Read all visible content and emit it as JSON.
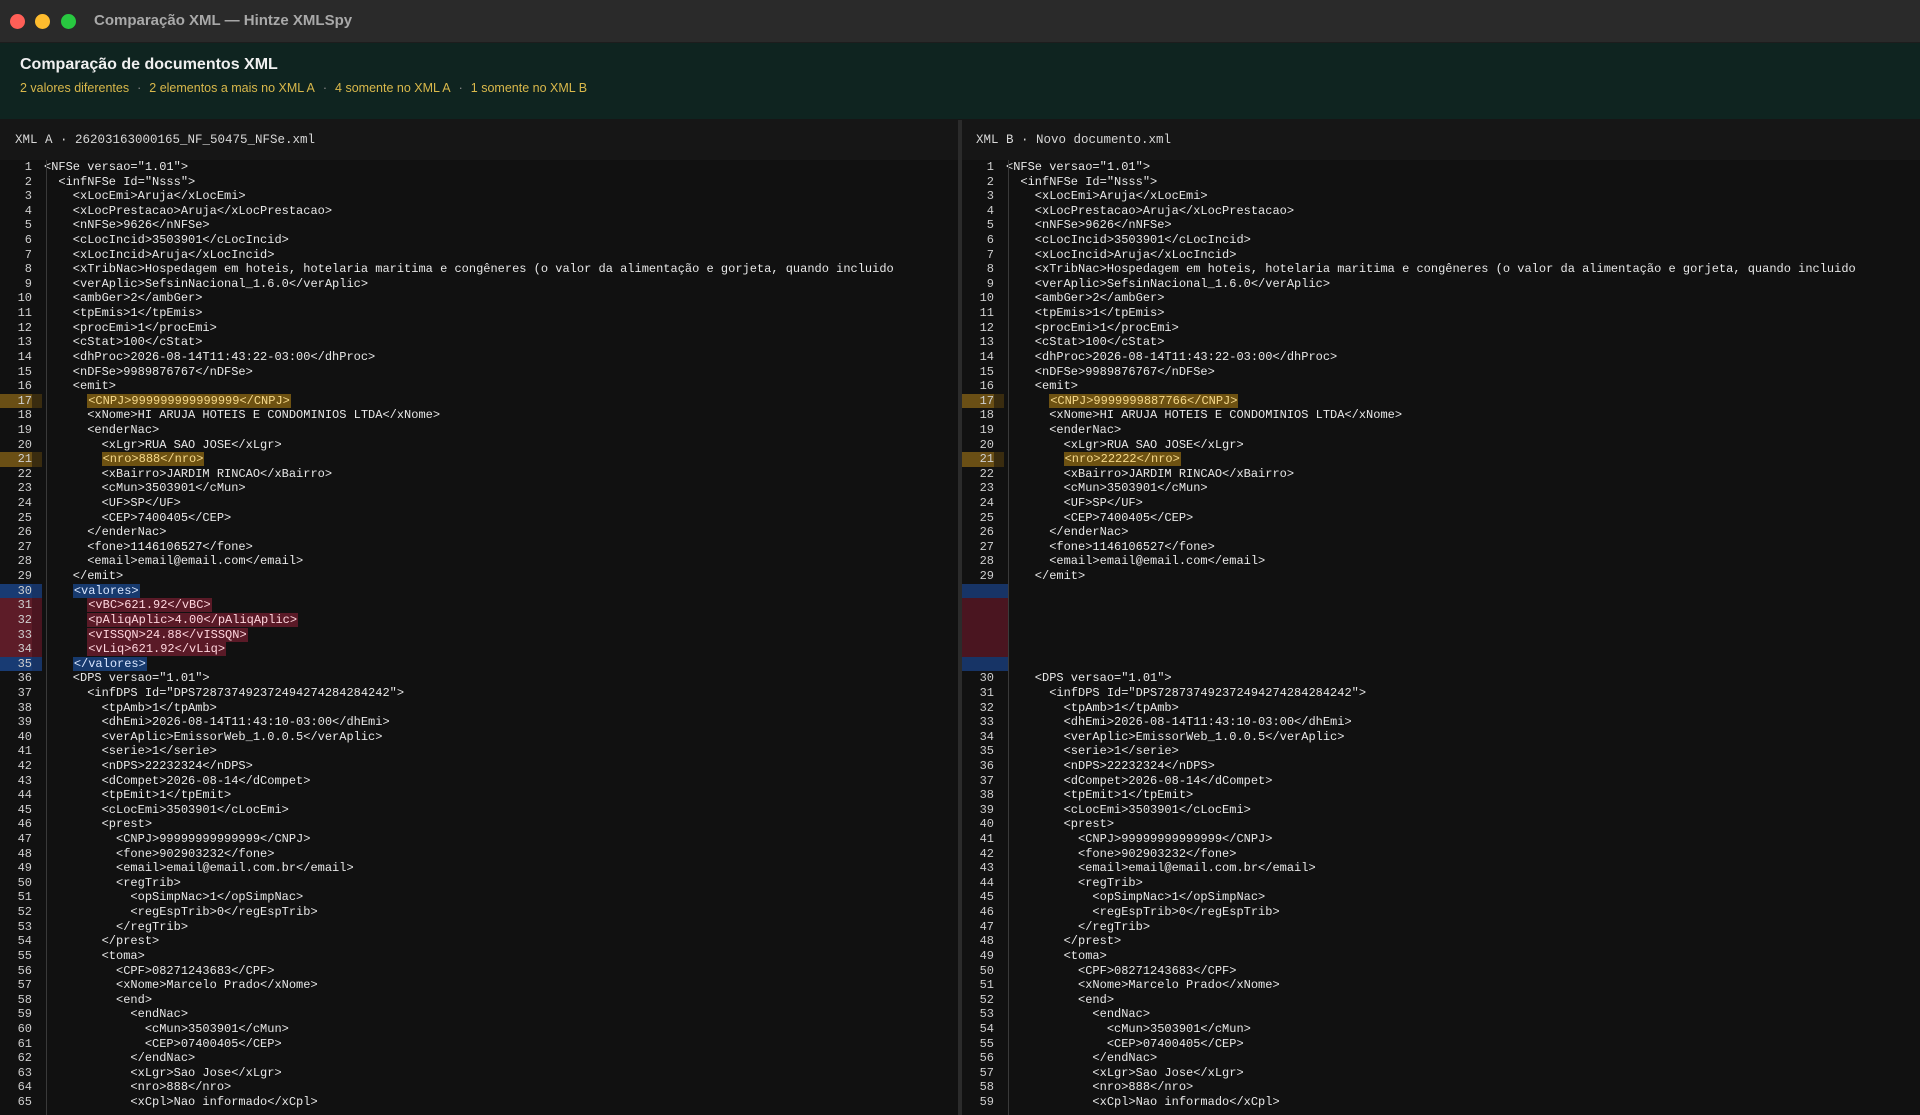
{
  "window": {
    "title": "Comparação XML — Hintze XMLSpy"
  },
  "header": {
    "title": "Comparação de documentos XML",
    "summary": [
      "2 valores diferentes",
      "2 elementos a mais no XML A",
      "4 somente no XML A",
      "1 somente no XML B"
    ]
  },
  "colors": {
    "changed": "#6e5212",
    "only_a_boundary": "#173a6e",
    "only_a_fill": "#5a1a27",
    "summary": "#d9b84b",
    "header_bg": "#0f2420"
  },
  "pane_a": {
    "label": "XML A · 26203163000165_NF_50475_NFSe.xml"
  },
  "pane_b": {
    "label": "XML B · Novo documento.xml"
  },
  "lines_a": [
    {
      "n": "1",
      "t": "<NFSe versao=\"1.01\">",
      "s": "normal"
    },
    {
      "n": "2",
      "t": "  <infNFSe Id=\"Nsss\">",
      "s": "normal"
    },
    {
      "n": "3",
      "t": "    <xLocEmi>Aruja</xLocEmi>",
      "s": "normal"
    },
    {
      "n": "4",
      "t": "    <xLocPrestacao>Aruja</xLocPrestacao>",
      "s": "normal"
    },
    {
      "n": "5",
      "t": "    <nNFSe>9626</nNFSe>",
      "s": "normal"
    },
    {
      "n": "6",
      "t": "    <cLocIncid>3503901</cLocIncid>",
      "s": "normal"
    },
    {
      "n": "7",
      "t": "    <xLocIncid>Aruja</xLocIncid>",
      "s": "normal"
    },
    {
      "n": "8",
      "t": "    <xTribNac>Hospedagem em hoteis, hotelaria maritima e congêneres (o valor da alimentação e gorjeta, quando incluido",
      "s": "normal"
    },
    {
      "n": "9",
      "t": "    <verAplic>SefsinNacional_1.6.0</verAplic>",
      "s": "normal"
    },
    {
      "n": "10",
      "t": "    <ambGer>2</ambGer>",
      "s": "normal"
    },
    {
      "n": "11",
      "t": "    <tpEmis>1</tpEmis>",
      "s": "normal"
    },
    {
      "n": "12",
      "t": "    <procEmi>1</procEmi>",
      "s": "normal"
    },
    {
      "n": "13",
      "t": "    <cStat>100</cStat>",
      "s": "normal"
    },
    {
      "n": "14",
      "t": "    <dhProc>2026-08-14T11:43:22-03:00</dhProc>",
      "s": "normal"
    },
    {
      "n": "15",
      "t": "    <nDFSe>9989876767</nDFSe>",
      "s": "normal"
    },
    {
      "n": "16",
      "t": "    <emit>",
      "s": "normal"
    },
    {
      "n": "17",
      "t": "      <CNPJ>999999999999999</CNPJ>",
      "s": "changed"
    },
    {
      "n": "18",
      "t": "      <xNome>HI ARUJA HOTEIS E CONDOMINIOS LTDA</xNome>",
      "s": "normal"
    },
    {
      "n": "19",
      "t": "      <enderNac>",
      "s": "normal"
    },
    {
      "n": "20",
      "t": "        <xLgr>RUA SAO JOSE</xLgr>",
      "s": "normal"
    },
    {
      "n": "21",
      "t": "        <nro>888</nro>",
      "s": "changed"
    },
    {
      "n": "22",
      "t": "        <xBairro>JARDIM RINCAO</xBairro>",
      "s": "normal"
    },
    {
      "n": "23",
      "t": "        <cMun>3503901</cMun>",
      "s": "normal"
    },
    {
      "n": "24",
      "t": "        <UF>SP</UF>",
      "s": "normal"
    },
    {
      "n": "25",
      "t": "        <CEP>7400405</CEP>",
      "s": "normal"
    },
    {
      "n": "26",
      "t": "      </enderNac>",
      "s": "normal"
    },
    {
      "n": "27",
      "t": "      <fone>1146106527</fone>",
      "s": "normal"
    },
    {
      "n": "28",
      "t": "      <email>email@email.com</email>",
      "s": "normal"
    },
    {
      "n": "29",
      "t": "    </emit>",
      "s": "normal"
    },
    {
      "n": "30",
      "t": "    <valores>",
      "s": "added-bound"
    },
    {
      "n": "31",
      "t": "      <vBC>621.92</vBC>",
      "s": "added"
    },
    {
      "n": "32",
      "t": "      <pAliqAplic>4.00</pAliqAplic>",
      "s": "added"
    },
    {
      "n": "33",
      "t": "      <vISSQN>24.88</vISSQN>",
      "s": "added"
    },
    {
      "n": "34",
      "t": "      <vLiq>621.92</vLiq>",
      "s": "added"
    },
    {
      "n": "35",
      "t": "    </valores>",
      "s": "added-bound"
    },
    {
      "n": "36",
      "t": "    <DPS versao=\"1.01\">",
      "s": "normal"
    },
    {
      "n": "37",
      "t": "      <infDPS Id=\"DPS728737492372494274284284242\">",
      "s": "normal"
    },
    {
      "n": "38",
      "t": "        <tpAmb>1</tpAmb>",
      "s": "normal"
    },
    {
      "n": "39",
      "t": "        <dhEmi>2026-08-14T11:43:10-03:00</dhEmi>",
      "s": "normal"
    },
    {
      "n": "40",
      "t": "        <verAplic>EmissorWeb_1.0.0.5</verAplic>",
      "s": "normal"
    },
    {
      "n": "41",
      "t": "        <serie>1</serie>",
      "s": "normal"
    },
    {
      "n": "42",
      "t": "        <nDPS>22232324</nDPS>",
      "s": "normal"
    },
    {
      "n": "43",
      "t": "        <dCompet>2026-08-14</dCompet>",
      "s": "normal"
    },
    {
      "n": "44",
      "t": "        <tpEmit>1</tpEmit>",
      "s": "normal"
    },
    {
      "n": "45",
      "t": "        <cLocEmi>3503901</cLocEmi>",
      "s": "normal"
    },
    {
      "n": "46",
      "t": "        <prest>",
      "s": "normal"
    },
    {
      "n": "47",
      "t": "          <CNPJ>99999999999999</CNPJ>",
      "s": "normal"
    },
    {
      "n": "48",
      "t": "          <fone>902903232</fone>",
      "s": "normal"
    },
    {
      "n": "49",
      "t": "          <email>email@email.com.br</email>",
      "s": "normal"
    },
    {
      "n": "50",
      "t": "          <regTrib>",
      "s": "normal"
    },
    {
      "n": "51",
      "t": "            <opSimpNac>1</opSimpNac>",
      "s": "normal"
    },
    {
      "n": "52",
      "t": "            <regEspTrib>0</regEspTrib>",
      "s": "normal"
    },
    {
      "n": "53",
      "t": "          </regTrib>",
      "s": "normal"
    },
    {
      "n": "54",
      "t": "        </prest>",
      "s": "normal"
    },
    {
      "n": "55",
      "t": "        <toma>",
      "s": "normal"
    },
    {
      "n": "56",
      "t": "          <CPF>08271243683</CPF>",
      "s": "normal"
    },
    {
      "n": "57",
      "t": "          <xNome>Marcelo Prado</xNome>",
      "s": "normal"
    },
    {
      "n": "58",
      "t": "          <end>",
      "s": "normal"
    },
    {
      "n": "59",
      "t": "            <endNac>",
      "s": "normal"
    },
    {
      "n": "60",
      "t": "              <cMun>3503901</cMun>",
      "s": "normal"
    },
    {
      "n": "61",
      "t": "              <CEP>07400405</CEP>",
      "s": "normal"
    },
    {
      "n": "62",
      "t": "            </endNac>",
      "s": "normal"
    },
    {
      "n": "63",
      "t": "            <xLgr>Sao Jose</xLgr>",
      "s": "normal"
    },
    {
      "n": "64",
      "t": "            <nro>888</nro>",
      "s": "normal"
    },
    {
      "n": "65",
      "t": "            <xCpl>Nao informado</xCpl>",
      "s": "normal"
    }
  ],
  "lines_b": [
    {
      "n": "1",
      "t": "<NFSe versao=\"1.01\">",
      "s": "normal"
    },
    {
      "n": "2",
      "t": "  <infNFSe Id=\"Nsss\">",
      "s": "normal"
    },
    {
      "n": "3",
      "t": "    <xLocEmi>Aruja</xLocEmi>",
      "s": "normal"
    },
    {
      "n": "4",
      "t": "    <xLocPrestacao>Aruja</xLocPrestacao>",
      "s": "normal"
    },
    {
      "n": "5",
      "t": "    <nNFSe>9626</nNFSe>",
      "s": "normal"
    },
    {
      "n": "6",
      "t": "    <cLocIncid>3503901</cLocIncid>",
      "s": "normal"
    },
    {
      "n": "7",
      "t": "    <xLocIncid>Aruja</xLocIncid>",
      "s": "normal"
    },
    {
      "n": "8",
      "t": "    <xTribNac>Hospedagem em hoteis, hotelaria maritima e congêneres (o valor da alimentação e gorjeta, quando incluido",
      "s": "normal"
    },
    {
      "n": "9",
      "t": "    <verAplic>SefsinNacional_1.6.0</verAplic>",
      "s": "normal"
    },
    {
      "n": "10",
      "t": "    <ambGer>2</ambGer>",
      "s": "normal"
    },
    {
      "n": "11",
      "t": "    <tpEmis>1</tpEmis>",
      "s": "normal"
    },
    {
      "n": "12",
      "t": "    <procEmi>1</procEmi>",
      "s": "normal"
    },
    {
      "n": "13",
      "t": "    <cStat>100</cStat>",
      "s": "normal"
    },
    {
      "n": "14",
      "t": "    <dhProc>2026-08-14T11:43:22-03:00</dhProc>",
      "s": "normal"
    },
    {
      "n": "15",
      "t": "    <nDFSe>9989876767</nDFSe>",
      "s": "normal"
    },
    {
      "n": "16",
      "t": "    <emit>",
      "s": "normal"
    },
    {
      "n": "17",
      "t": "      <CNPJ>9999999887766</CNPJ>",
      "s": "changed"
    },
    {
      "n": "18",
      "t": "      <xNome>HI ARUJA HOTEIS E CONDOMINIOS LTDA</xNome>",
      "s": "normal"
    },
    {
      "n": "19",
      "t": "      <enderNac>",
      "s": "normal"
    },
    {
      "n": "20",
      "t": "        <xLgr>RUA SAO JOSE</xLgr>",
      "s": "normal"
    },
    {
      "n": "21",
      "t": "        <nro>22222</nro>",
      "s": "changed"
    },
    {
      "n": "22",
      "t": "        <xBairro>JARDIM RINCAO</xBairro>",
      "s": "normal"
    },
    {
      "n": "23",
      "t": "        <cMun>3503901</cMun>",
      "s": "normal"
    },
    {
      "n": "24",
      "t": "        <UF>SP</UF>",
      "s": "normal"
    },
    {
      "n": "25",
      "t": "        <CEP>7400405</CEP>",
      "s": "normal"
    },
    {
      "n": "26",
      "t": "      </enderNac>",
      "s": "normal"
    },
    {
      "n": "27",
      "t": "      <fone>1146106527</fone>",
      "s": "normal"
    },
    {
      "n": "28",
      "t": "      <email>email@email.com</email>",
      "s": "normal"
    },
    {
      "n": "29",
      "t": "    </emit>",
      "s": "normal"
    },
    {
      "n": "",
      "t": "",
      "s": "ph-bound"
    },
    {
      "n": "",
      "t": "",
      "s": "ph-fill"
    },
    {
      "n": "",
      "t": "",
      "s": "ph-fill"
    },
    {
      "n": "",
      "t": "",
      "s": "ph-fill"
    },
    {
      "n": "",
      "t": "",
      "s": "ph-fill"
    },
    {
      "n": "",
      "t": "",
      "s": "ph-bound"
    },
    {
      "n": "30",
      "t": "    <DPS versao=\"1.01\">",
      "s": "normal"
    },
    {
      "n": "31",
      "t": "      <infDPS Id=\"DPS728737492372494274284284242\">",
      "s": "normal"
    },
    {
      "n": "32",
      "t": "        <tpAmb>1</tpAmb>",
      "s": "normal"
    },
    {
      "n": "33",
      "t": "        <dhEmi>2026-08-14T11:43:10-03:00</dhEmi>",
      "s": "normal"
    },
    {
      "n": "34",
      "t": "        <verAplic>EmissorWeb_1.0.0.5</verAplic>",
      "s": "normal"
    },
    {
      "n": "35",
      "t": "        <serie>1</serie>",
      "s": "normal"
    },
    {
      "n": "36",
      "t": "        <nDPS>22232324</nDPS>",
      "s": "normal"
    },
    {
      "n": "37",
      "t": "        <dCompet>2026-08-14</dCompet>",
      "s": "normal"
    },
    {
      "n": "38",
      "t": "        <tpEmit>1</tpEmit>",
      "s": "normal"
    },
    {
      "n": "39",
      "t": "        <cLocEmi>3503901</cLocEmi>",
      "s": "normal"
    },
    {
      "n": "40",
      "t": "        <prest>",
      "s": "normal"
    },
    {
      "n": "41",
      "t": "          <CNPJ>99999999999999</CNPJ>",
      "s": "normal"
    },
    {
      "n": "42",
      "t": "          <fone>902903232</fone>",
      "s": "normal"
    },
    {
      "n": "43",
      "t": "          <email>email@email.com.br</email>",
      "s": "normal"
    },
    {
      "n": "44",
      "t": "          <regTrib>",
      "s": "normal"
    },
    {
      "n": "45",
      "t": "            <opSimpNac>1</opSimpNac>",
      "s": "normal"
    },
    {
      "n": "46",
      "t": "            <regEspTrib>0</regEspTrib>",
      "s": "normal"
    },
    {
      "n": "47",
      "t": "          </regTrib>",
      "s": "normal"
    },
    {
      "n": "48",
      "t": "        </prest>",
      "s": "normal"
    },
    {
      "n": "49",
      "t": "        <toma>",
      "s": "normal"
    },
    {
      "n": "50",
      "t": "          <CPF>08271243683</CPF>",
      "s": "normal"
    },
    {
      "n": "51",
      "t": "          <xNome>Marcelo Prado</xNome>",
      "s": "normal"
    },
    {
      "n": "52",
      "t": "          <end>",
      "s": "normal"
    },
    {
      "n": "53",
      "t": "            <endNac>",
      "s": "normal"
    },
    {
      "n": "54",
      "t": "              <cMun>3503901</cMun>",
      "s": "normal"
    },
    {
      "n": "55",
      "t": "              <CEP>07400405</CEP>",
      "s": "normal"
    },
    {
      "n": "56",
      "t": "            </endNac>",
      "s": "normal"
    },
    {
      "n": "57",
      "t": "            <xLgr>Sao Jose</xLgr>",
      "s": "normal"
    },
    {
      "n": "58",
      "t": "            <nro>888</nro>",
      "s": "normal"
    },
    {
      "n": "59",
      "t": "            <xCpl>Nao informado</xCpl>",
      "s": "normal"
    }
  ]
}
